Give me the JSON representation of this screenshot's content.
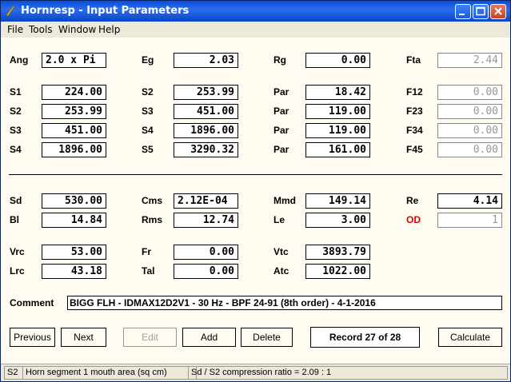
{
  "window": {
    "title": "Hornresp - Input Parameters"
  },
  "menu": [
    "File",
    "Tools",
    "Window",
    "Help"
  ],
  "row1": {
    "ang": {
      "label": "Ang",
      "value": "2.0 x Pi"
    },
    "eg": {
      "label": "Eg",
      "value": "2.03"
    },
    "rg": {
      "label": "Rg",
      "value": "0.00"
    },
    "fta": {
      "label": "Fta",
      "value": "2.44"
    }
  },
  "horn": [
    {
      "a_label": "S1",
      "a_value": "224.00",
      "b_label": "S2",
      "b_value": "253.99",
      "c_label": "Par",
      "c_value": "18.42",
      "d_label": "F12",
      "d_value": "0.00"
    },
    {
      "a_label": "S2",
      "a_value": "253.99",
      "b_label": "S3",
      "b_value": "451.00",
      "c_label": "Par",
      "c_value": "119.00",
      "d_label": "F23",
      "d_value": "0.00"
    },
    {
      "a_label": "S3",
      "a_value": "451.00",
      "b_label": "S4",
      "b_value": "1896.00",
      "c_label": "Par",
      "c_value": "119.00",
      "d_label": "F34",
      "d_value": "0.00"
    },
    {
      "a_label": "S4",
      "a_value": "1896.00",
      "b_label": "S5",
      "b_value": "3290.32",
      "c_label": "Par",
      "c_value": "161.00",
      "d_label": "F45",
      "d_value": "0.00"
    }
  ],
  "driver": {
    "sd": {
      "label": "Sd",
      "value": "530.00"
    },
    "cms": {
      "label": "Cms",
      "value": "2.12E-04"
    },
    "mmd": {
      "label": "Mmd",
      "value": "149.14"
    },
    "re": {
      "label": "Re",
      "value": "4.14"
    },
    "bl": {
      "label": "Bl",
      "value": "14.84"
    },
    "rms": {
      "label": "Rms",
      "value": "12.74"
    },
    "le": {
      "label": "Le",
      "value": "3.00"
    },
    "od": {
      "label": "OD",
      "value": "1"
    }
  },
  "chamber": {
    "vrc": {
      "label": "Vrc",
      "value": "53.00"
    },
    "fr": {
      "label": "Fr",
      "value": "0.00"
    },
    "vtc": {
      "label": "Vtc",
      "value": "3893.79"
    },
    "lrc": {
      "label": "Lrc",
      "value": "43.18"
    },
    "tal": {
      "label": "Tal",
      "value": "0.00"
    },
    "atc": {
      "label": "Atc",
      "value": "1022.00"
    }
  },
  "comment": {
    "label": "Comment",
    "value": "BIGG FLH - IDMAX12D2V1 - 30 Hz - BPF 24-91 (8th order) - 4-1-2016"
  },
  "buttons": {
    "previous": "Previous",
    "next": "Next",
    "edit": "Edit",
    "add": "Add",
    "delete": "Delete",
    "calculate": "Calculate"
  },
  "record": "Record 27 of 28",
  "status": {
    "field": "S2",
    "description": "Horn segment 1 mouth area (sq cm)",
    "ratio": "Sd / S2 compression ratio = 2.09 : 1"
  }
}
